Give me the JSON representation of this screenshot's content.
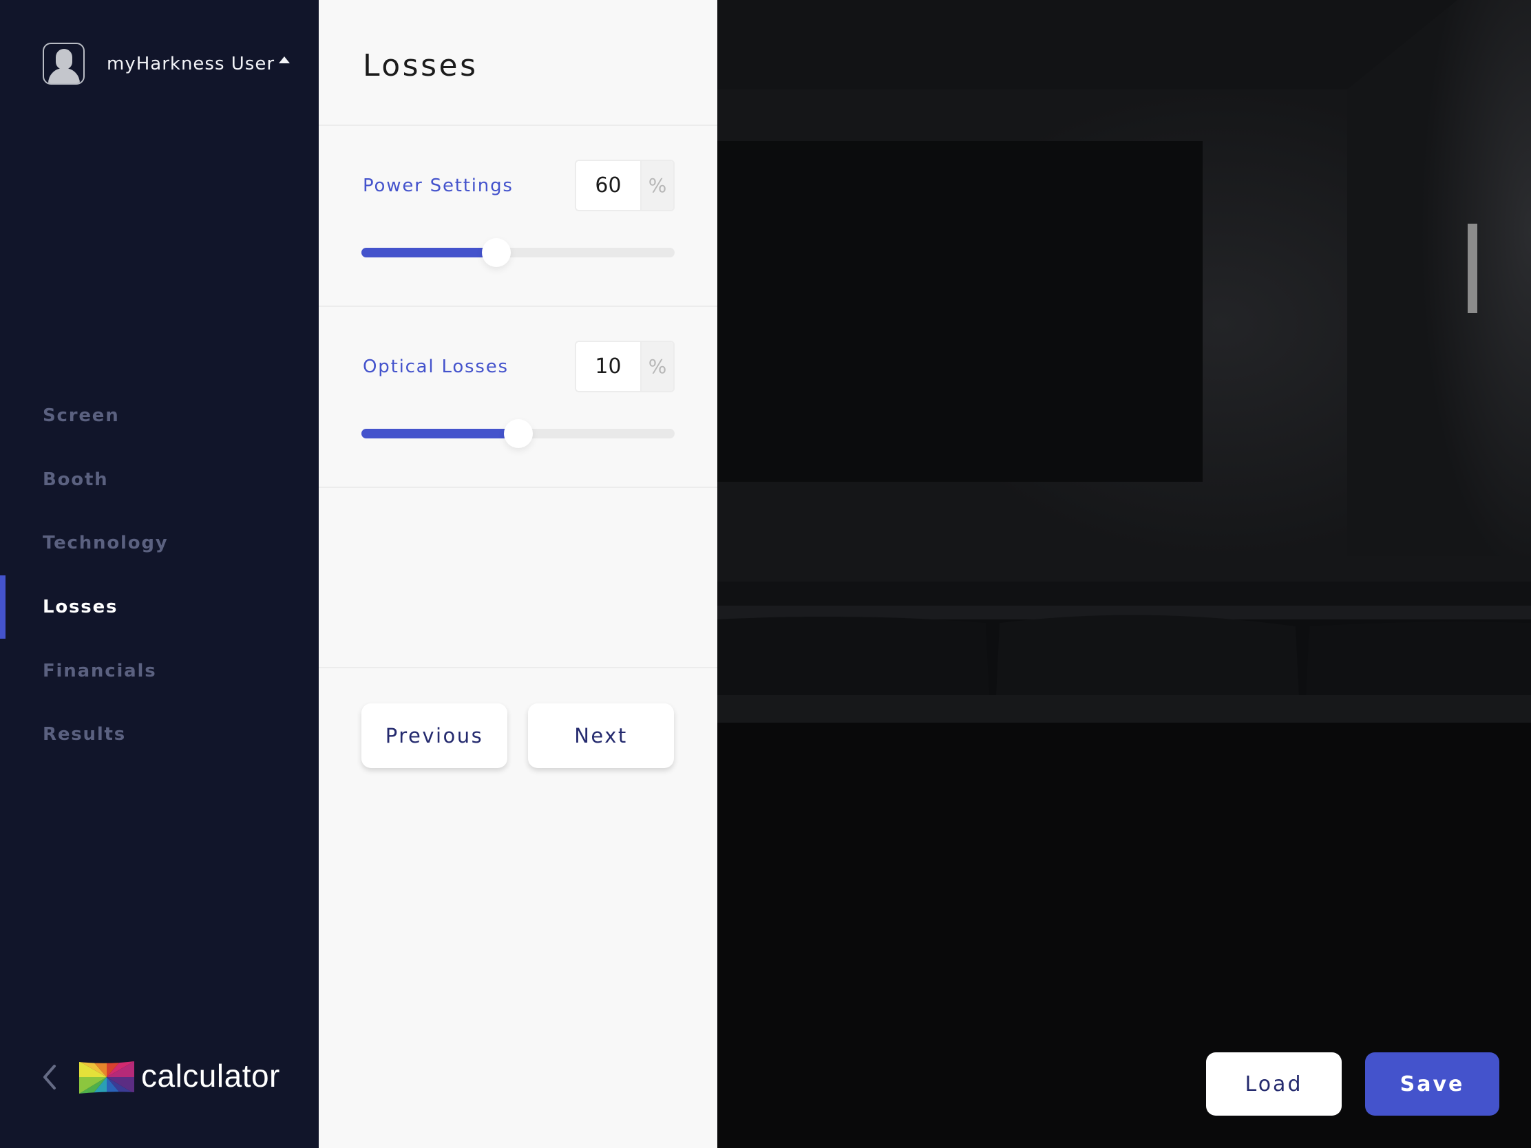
{
  "user": {
    "name": "myHarkness User",
    "avatar_icon": "user-avatar-icon",
    "menu_icon": "caret-up-icon"
  },
  "sidebar": {
    "items": [
      {
        "label": "Screen",
        "active": false
      },
      {
        "label": "Booth",
        "active": false
      },
      {
        "label": "Technology",
        "active": false
      },
      {
        "label": "Losses",
        "active": true
      },
      {
        "label": "Financials",
        "active": false
      },
      {
        "label": "Results",
        "active": false
      }
    ],
    "back_icon": "chevron-left-icon",
    "brand": "calculator",
    "accent_color": "#4453cc"
  },
  "panel": {
    "title": "Losses",
    "fields": [
      {
        "label": "Power Settings",
        "value": "60",
        "unit": "%",
        "slider_fraction": 0.43
      },
      {
        "label": "Optical Losses",
        "value": "10",
        "unit": "%",
        "slider_fraction": 0.5
      }
    ],
    "previous_label": "Previous",
    "next_label": "Next"
  },
  "actions": {
    "load_label": "Load",
    "save_label": "Save"
  }
}
